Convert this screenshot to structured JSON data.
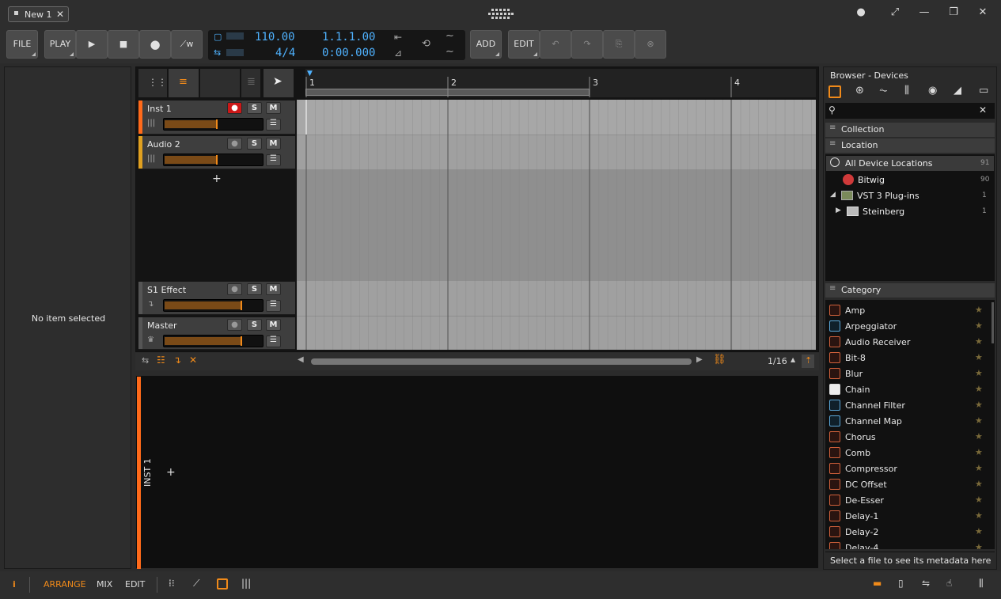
{
  "window": {
    "tab_title": "New 1",
    "tab_close": "✕"
  },
  "toolbar": {
    "file": "FILE",
    "play_label": "PLAY",
    "add": "ADD",
    "edit": "EDIT",
    "tempo": "110.00",
    "signature": "4/4",
    "position": "1.1.1.00",
    "time": "0:00.000"
  },
  "inspector": {
    "empty": "No item selected"
  },
  "arrange": {
    "ruler": [
      "1",
      "2",
      "3",
      "4"
    ],
    "tracks": [
      {
        "name": "Inst 1",
        "color": "#ff6a1a",
        "level": 0.52
      },
      {
        "name": "Audio 2",
        "color": "#e0a020",
        "level": 0.52
      },
      {
        "name": "S1 Effect",
        "color": "#555555",
        "level": 0.77
      },
      {
        "name": "Master",
        "color": "#555555",
        "level": 0.77
      }
    ],
    "solo": "S",
    "mute": "M",
    "add": "+",
    "grid": "1/16"
  },
  "device_panel": {
    "track": "INST 1",
    "add": "+"
  },
  "browser": {
    "title": "Browser - Devices",
    "collection": "Collection",
    "location": "Location",
    "locations": [
      {
        "name": "All Device Locations",
        "count": "91"
      },
      {
        "name": "Bitwig",
        "count": "90"
      },
      {
        "name": "VST 3 Plug-ins",
        "count": "1"
      },
      {
        "name": "Steinberg",
        "count": "1"
      }
    ],
    "category": "Category",
    "categories": [
      {
        "name": "Amp",
        "kind": "r"
      },
      {
        "name": "Arpeggiator",
        "kind": "b"
      },
      {
        "name": "Audio Receiver",
        "kind": "r"
      },
      {
        "name": "Bit-8",
        "kind": "r"
      },
      {
        "name": "Blur",
        "kind": "r"
      },
      {
        "name": "Chain",
        "kind": "w"
      },
      {
        "name": "Channel Filter",
        "kind": "b"
      },
      {
        "name": "Channel Map",
        "kind": "b"
      },
      {
        "name": "Chorus",
        "kind": "r"
      },
      {
        "name": "Comb",
        "kind": "r"
      },
      {
        "name": "Compressor",
        "kind": "r"
      },
      {
        "name": "DC Offset",
        "kind": "r"
      },
      {
        "name": "De-Esser",
        "kind": "r"
      },
      {
        "name": "Delay-1",
        "kind": "r"
      },
      {
        "name": "Delay-2",
        "kind": "r"
      },
      {
        "name": "Delay-4",
        "kind": "r"
      }
    ],
    "metadata": "Select a file to see its metadata here"
  },
  "bottom": {
    "arrange": "ARRANGE",
    "mix": "MIX",
    "edit": "EDIT",
    "info": "i"
  }
}
